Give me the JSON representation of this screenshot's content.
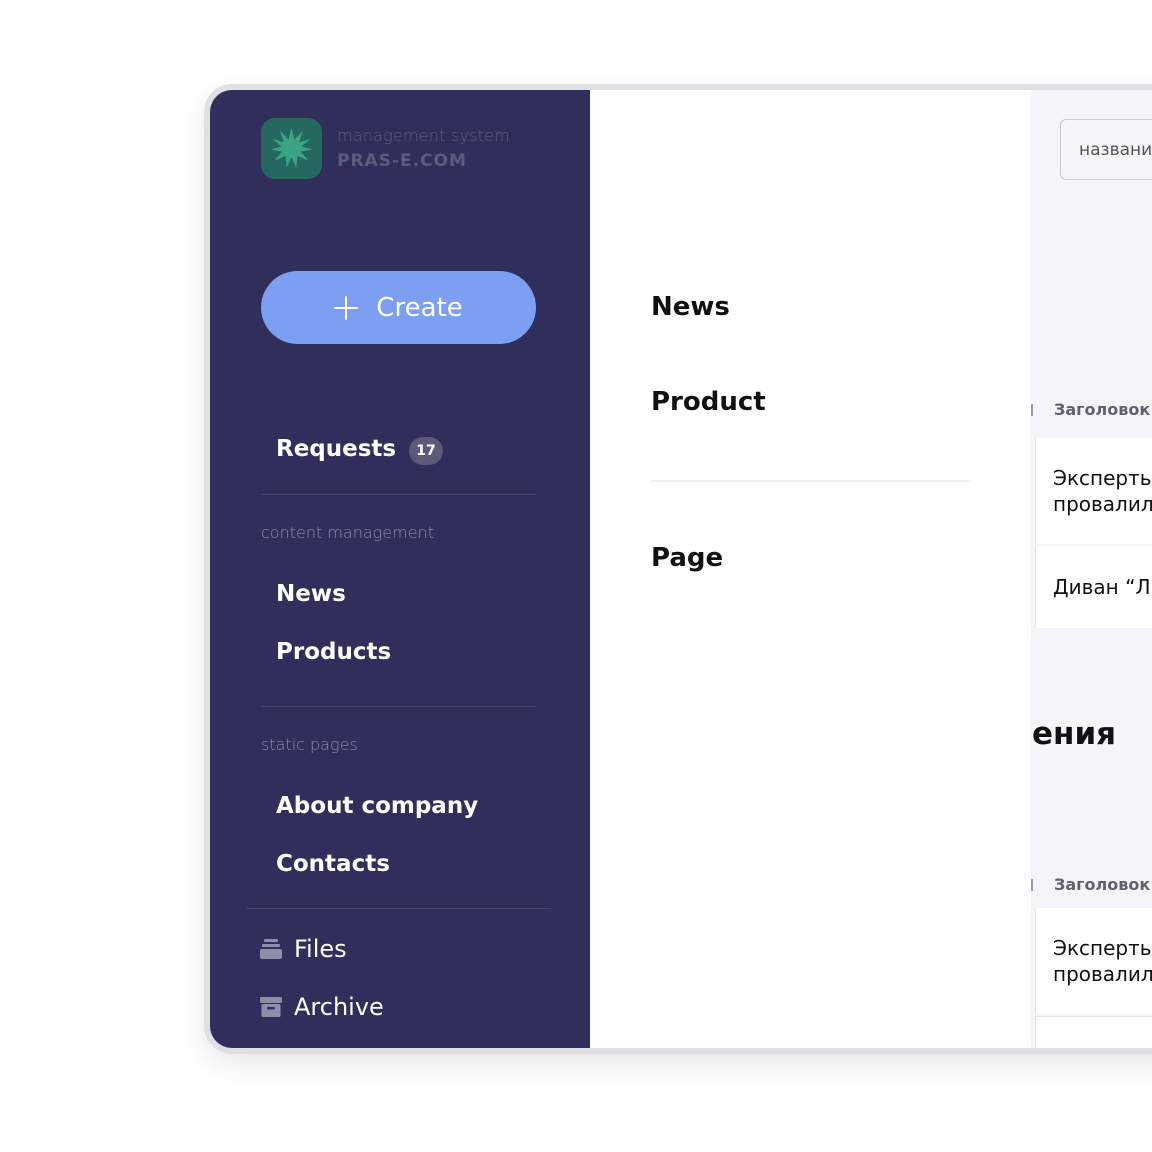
{
  "brand": {
    "subtitle": "management system",
    "name": "PRAS-E.COM"
  },
  "sidebar": {
    "create_label": "Create",
    "requests": {
      "label": "Requests",
      "count": "17"
    },
    "sections": [
      {
        "label": "content management",
        "items": [
          "News",
          "Products"
        ]
      },
      {
        "label": "static pages",
        "items": [
          "About company",
          "Contacts"
        ]
      }
    ],
    "utilities": [
      {
        "label": "Files",
        "icon": "files-icon"
      },
      {
        "label": "Archive",
        "icon": "archive-icon"
      }
    ]
  },
  "create_menu": {
    "items": [
      "News",
      "Product",
      "Page"
    ]
  },
  "content": {
    "search_placeholder": "названи",
    "table1": {
      "column": "Заголовок",
      "rows": [
        [
          "Эксперты",
          "провалил"
        ],
        [
          "Диван “Л"
        ]
      ]
    },
    "section_heading": "ения",
    "table2": {
      "column": "Заголовок",
      "rows": [
        [
          "Эксперты",
          "провалил"
        ]
      ]
    }
  },
  "colors": {
    "sidebar_bg": "#302f5b",
    "accent": "#7d9ff1",
    "logo_bg": "#24685f"
  }
}
